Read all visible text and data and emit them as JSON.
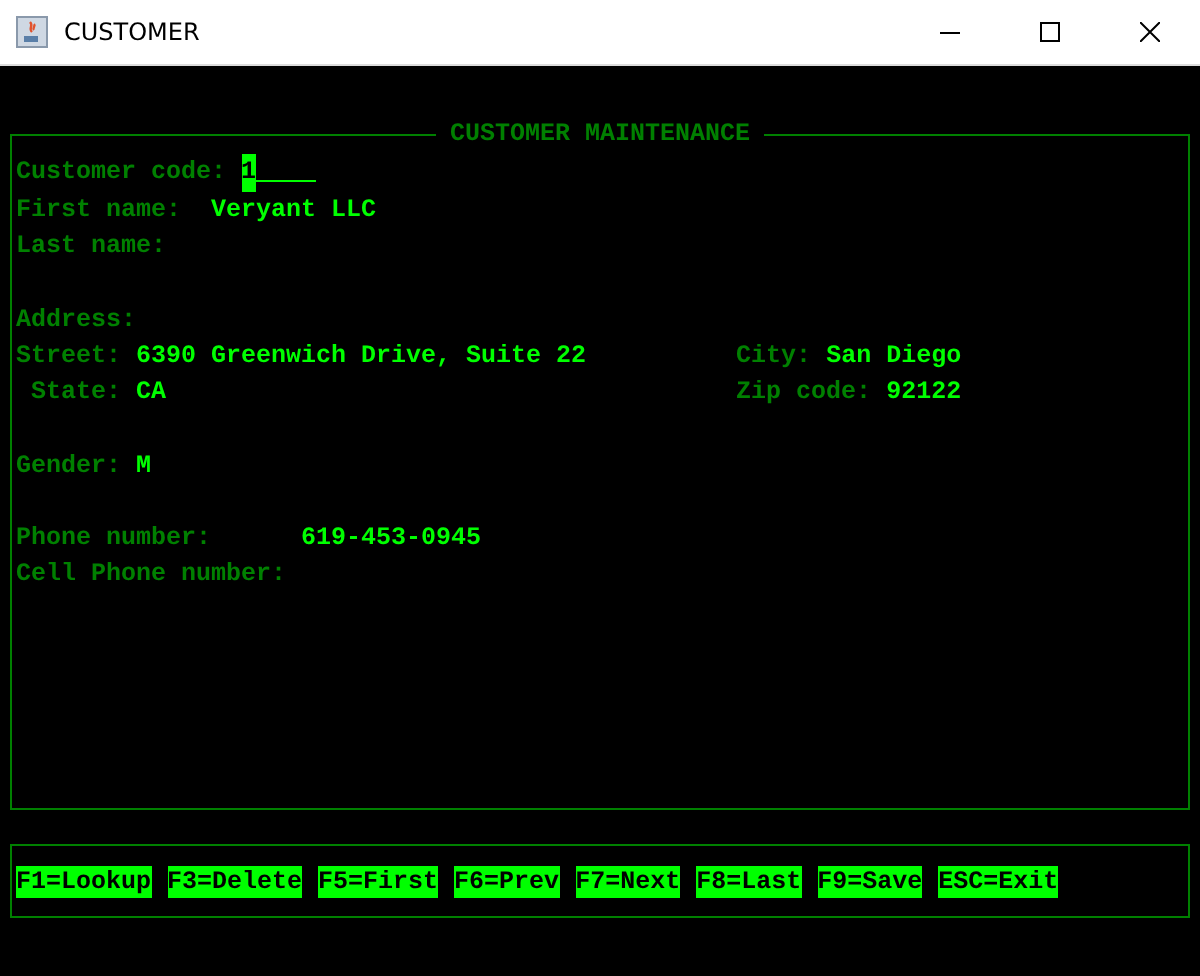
{
  "window": {
    "title": "CUSTOMER"
  },
  "panel": {
    "title": "CUSTOMER MAINTENANCE",
    "groups": [
      {
        "rows": [
          {
            "fields": [
              {
                "label": "Customer code:",
                "value": "1",
                "focused": true
              }
            ]
          },
          {
            "fields": [
              {
                "label": "First name:",
                "value": "Veryant LLC"
              }
            ]
          },
          {
            "fields": [
              {
                "label": "Last name:"
              }
            ]
          }
        ]
      },
      {
        "rows": [
          {
            "fields": [
              {
                "label": "Address:"
              }
            ]
          },
          {
            "fields": [
              {
                "label": "Street:",
                "value": "6390 Greenwich Drive, Suite 22"
              },
              {
                "label": "City:",
                "value": "San Diego"
              }
            ]
          },
          {
            "fields": [
              {
                "label": "State:",
                "value": "CA"
              },
              {
                "label": "Zip code:",
                "value": "92122"
              }
            ]
          }
        ]
      },
      {
        "rows": [
          {
            "fields": [
              {
                "label": "Gender:",
                "value": "M"
              }
            ]
          }
        ]
      },
      {
        "rows": [
          {
            "fields": [
              {
                "label": "Phone number:",
                "value": "619-453-0945"
              }
            ]
          },
          {
            "fields": [
              {
                "label": "Cell Phone number:"
              }
            ]
          }
        ]
      }
    ]
  },
  "function_keys": [
    "F1=Lookup",
    "F3=Delete",
    "F5=First",
    "F6=Prev",
    "F7=Next",
    "F8=Last",
    "F9=Save",
    "ESC=Exit"
  ]
}
